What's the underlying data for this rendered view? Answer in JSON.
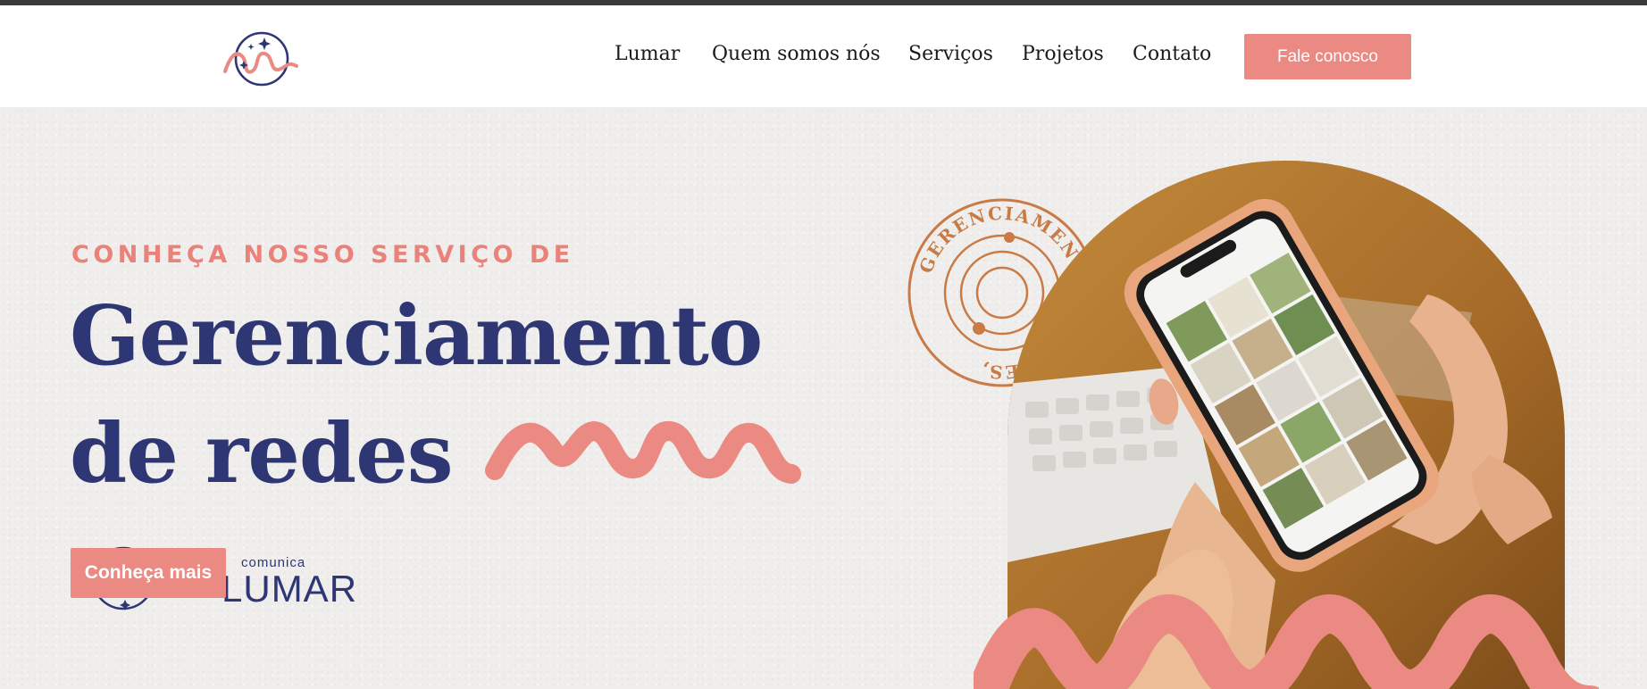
{
  "nav": {
    "logo_icon": "lumar-logo-icon",
    "items": [
      {
        "label": "Lumar"
      },
      {
        "label": "Quem somos nós"
      },
      {
        "label": "Serviços"
      },
      {
        "label": "Projetos"
      },
      {
        "label": "Contato"
      }
    ],
    "cta_label": "Fale conosco"
  },
  "hero": {
    "eyebrow": "CONHEÇA NOSSO SERVIÇO DE",
    "headline_line1": "Gerenciamento",
    "headline_line2": "de redes",
    "button_label": "Conheça mais",
    "brand_tag": "comunica",
    "brand_name": "LUMAR",
    "stamp_text": "GERENCIAMENTO DE REDES,",
    "photo_icon": "hand-holding-phone-photo"
  },
  "colors": {
    "navy": "#2e3673",
    "coral": "#ea8a82",
    "stamp": "#c97a45",
    "hero_bg": "#efeeec"
  }
}
